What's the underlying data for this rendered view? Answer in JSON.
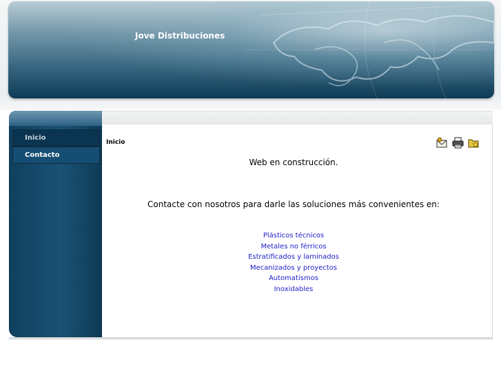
{
  "header": {
    "title": "Jove Distribuciones"
  },
  "sidebar": {
    "items": [
      {
        "label": "Inicio",
        "active": true
      },
      {
        "label": "Contacto",
        "active": false
      }
    ]
  },
  "content": {
    "breadcrumb": "Inicio",
    "toolbar": {
      "icons": [
        "email-icon",
        "print-icon",
        "pdf-icon"
      ]
    },
    "heading": "Web en construcción.",
    "intro": "Contacte con nosotros para darle las soluciones más convenientes en:",
    "links": [
      "Plásticos técnicos",
      "Metales no férricos",
      "Estratificados y laminados",
      "Mecanizados y proyectos",
      "Automatismos",
      "Inoxidables"
    ]
  },
  "colors": {
    "sidebar": "#154e72",
    "link": "#1c1cc8"
  }
}
